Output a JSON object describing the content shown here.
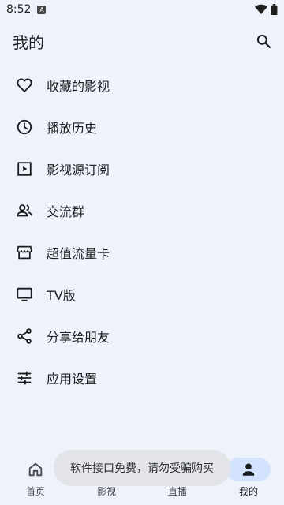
{
  "status": {
    "time": "8:52",
    "notif_glyph": "A"
  },
  "header": {
    "title": "我的"
  },
  "menu": [
    {
      "label": "收藏的影视",
      "icon": "heart-icon"
    },
    {
      "label": "播放历史",
      "icon": "clock-icon"
    },
    {
      "label": "影视源订阅",
      "icon": "play-box-icon"
    },
    {
      "label": "交流群",
      "icon": "people-icon"
    },
    {
      "label": "超值流量卡",
      "icon": "store-icon"
    },
    {
      "label": "TV版",
      "icon": "tv-icon"
    },
    {
      "label": "分享给朋友",
      "icon": "share-icon"
    },
    {
      "label": "应用设置",
      "icon": "sliders-icon"
    }
  ],
  "nav": [
    {
      "label": "首页",
      "icon": "home-icon",
      "active": false
    },
    {
      "label": "影视",
      "icon": "video-icon",
      "active": false
    },
    {
      "label": "直播",
      "icon": "live-icon",
      "active": false
    },
    {
      "label": "我的",
      "icon": "person-icon",
      "active": true
    }
  ],
  "toast": {
    "text": "软件接口免费，请勿受骗购买"
  },
  "colors": {
    "background": "#eef2fa",
    "active_pill": "#d3e3fd",
    "toast_bg": "#e2e4ea"
  }
}
